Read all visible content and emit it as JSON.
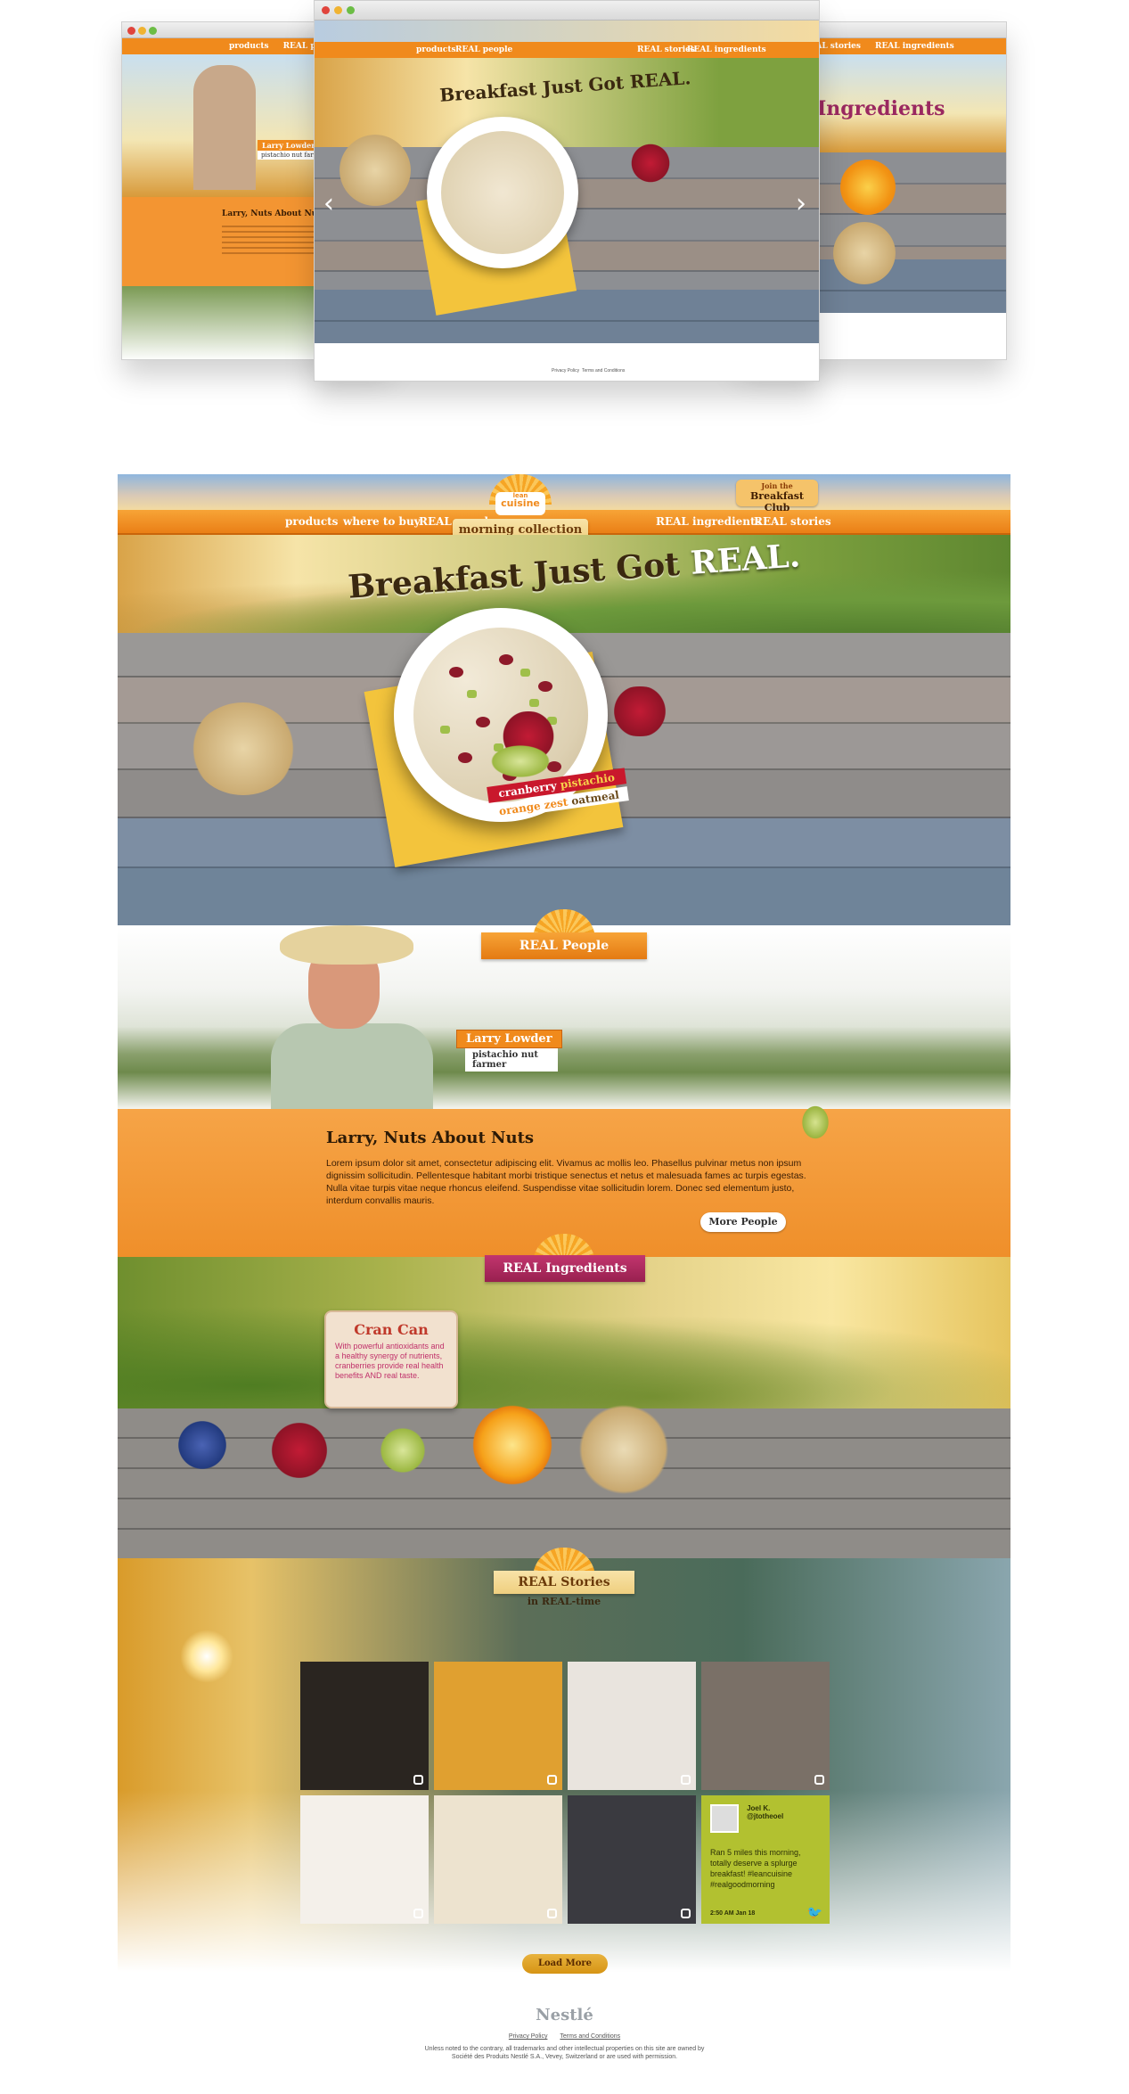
{
  "preview": {
    "left_nav": [
      "products",
      "REAL people"
    ],
    "center_nav_left": [
      "products",
      "REAL people"
    ],
    "center_nav_right": [
      "REAL stories",
      "REAL ingredients"
    ],
    "right_nav": [
      "REAL stories",
      "REAL ingredients"
    ],
    "left_story_title": "Larry, Nuts About Nuts",
    "left_name": "Larry Lowder",
    "left_job": "pistachio nut farmer",
    "right_heading": "Ingredients",
    "headline": "Breakfast Just Got REAL.",
    "footer_links": [
      "Privacy Policy",
      "Terms and Conditions"
    ]
  },
  "header": {
    "brand_small": "lean",
    "brand": "cuisine",
    "collection": "morning collection",
    "club_small": "Join the",
    "club_label": "Breakfast Club",
    "nav_left": [
      "products",
      "where to buy",
      "REAL people"
    ],
    "nav_right": [
      "REAL ingredients",
      "REAL stories"
    ]
  },
  "hero": {
    "headline_part1": "Breakfast Just Got ",
    "headline_part2": "REAL.",
    "product_line1a": "cranberry ",
    "product_line1b": "pistachio",
    "product_line2a": "orange zest",
    "product_line2b": " oatmeal",
    "prev_arrow": "‹",
    "next_arrow": "›",
    "slides": 5,
    "active_slide": 3
  },
  "people": {
    "ribbon": "REAL People",
    "name": "Larry Lowder",
    "job": "pistachio nut farmer",
    "title": "Larry, Nuts About Nuts",
    "body": "Lorem ipsum dolor sit amet, consectetur adipiscing elit. Vivamus ac mollis leo. Phasellus pulvinar metus non ipsum dignissim sollicitudin. Pellentesque habitant morbi tristique senectus et netus et malesuada fames ac turpis egestas. Nulla vitae turpis vitae neque rhoncus eleifend. Suspendisse vitae sollicitudin lorem. Donec sed elementum justo, interdum convallis mauris.",
    "more_button": "More People"
  },
  "ingredients": {
    "ribbon": "REAL Ingredients",
    "card_title": "Cran Can",
    "card_body": "With powerful antioxidants and a healthy synergy of nutrients, cranberries provide real health benefits AND real taste."
  },
  "stories": {
    "ribbon": "REAL Stories",
    "subtitle": "in REAL-time",
    "tiles": [
      {
        "kind": "coffee",
        "color": "#2a2520"
      },
      {
        "kind": "runner",
        "color": "#e0a030"
      },
      {
        "kind": "woman-waking",
        "color": "#e9e4de"
      },
      {
        "kind": "sandwich",
        "color": "#7a7067"
      },
      {
        "kind": "lean-cuisine-box",
        "color": "#f4f0ea"
      },
      {
        "kind": "oatmeal-bowl",
        "color": "#ede3cf"
      },
      {
        "kind": "breakfast-plate",
        "color": "#3a3a40"
      }
    ],
    "tweet": {
      "name": "Joel K.",
      "handle": "@jtotheoel",
      "text": "Ran 5 miles this morning, totally deserve a splurge breakfast! #leancuisine #realgoodmorning",
      "time": "2:50 AM Jan 18"
    },
    "load_more": "Load More"
  },
  "footer": {
    "brand": "Nestlé",
    "links": [
      "Privacy Policy",
      "Terms and Conditions"
    ],
    "copyright": "Unless noted to the contrary, all trademarks and other intellectual properties on this site are owned by Société des Produits Nestlé S.A., Vevey, Switzerland or are used with permission."
  }
}
